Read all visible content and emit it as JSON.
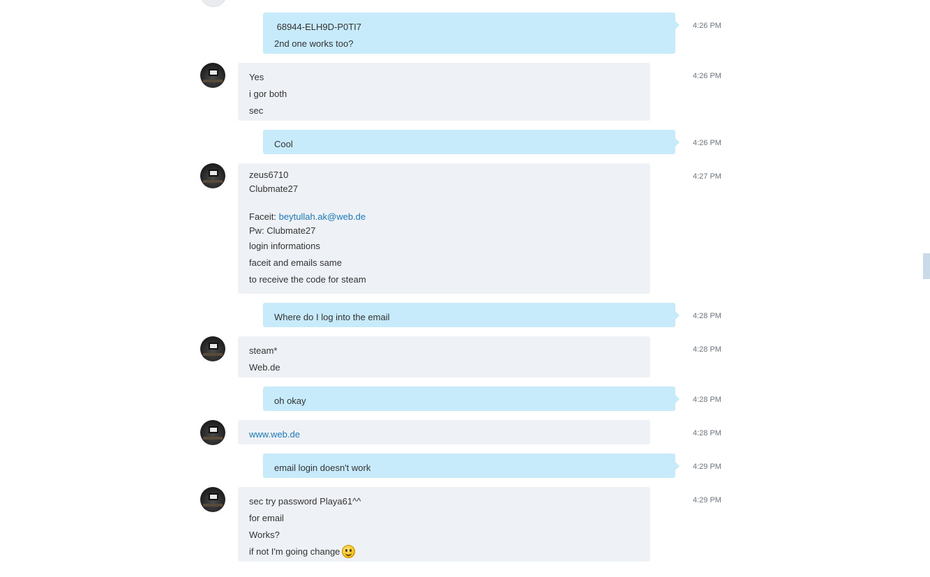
{
  "messages": [
    {
      "dir": "out",
      "time": "4:26 PM",
      "lines": [
        " 68944-ELH9D-P0TI7",
        "2nd one works too?"
      ]
    },
    {
      "dir": "in",
      "time": "4:26 PM",
      "lines": [
        "Yes",
        "i gor both",
        "sec"
      ]
    },
    {
      "dir": "out",
      "time": "4:26 PM",
      "lines": [
        "Cool"
      ]
    },
    {
      "dir": "in",
      "time": "4:27 PM",
      "lines": [
        "zeus6710",
        "Clubmate27",
        "",
        "Faceit:",
        "Pw: Clubmate27",
        "login informations",
        "faceit and emails same",
        "to receive the code for steam"
      ],
      "link": "beytullah.ak@web.de"
    },
    {
      "dir": "out",
      "time": "4:28 PM",
      "lines": [
        "Where do I log into the email"
      ]
    },
    {
      "dir": "in",
      "time": "4:28 PM",
      "lines": [
        "steam*",
        "Web.de"
      ]
    },
    {
      "dir": "out",
      "time": "4:28 PM",
      "lines": [
        "oh okay"
      ]
    },
    {
      "dir": "in",
      "time": "4:28 PM",
      "link": "www.web.de"
    },
    {
      "dir": "out",
      "time": "4:29 PM",
      "lines": [
        "email login doesn't work"
      ]
    },
    {
      "dir": "in",
      "time": "4:29 PM",
      "lines": [
        "sec try password Playa61^^",
        "for email",
        "Works?",
        "if not I'm going change"
      ],
      "emoticon": "smiley-face-icon"
    }
  ]
}
